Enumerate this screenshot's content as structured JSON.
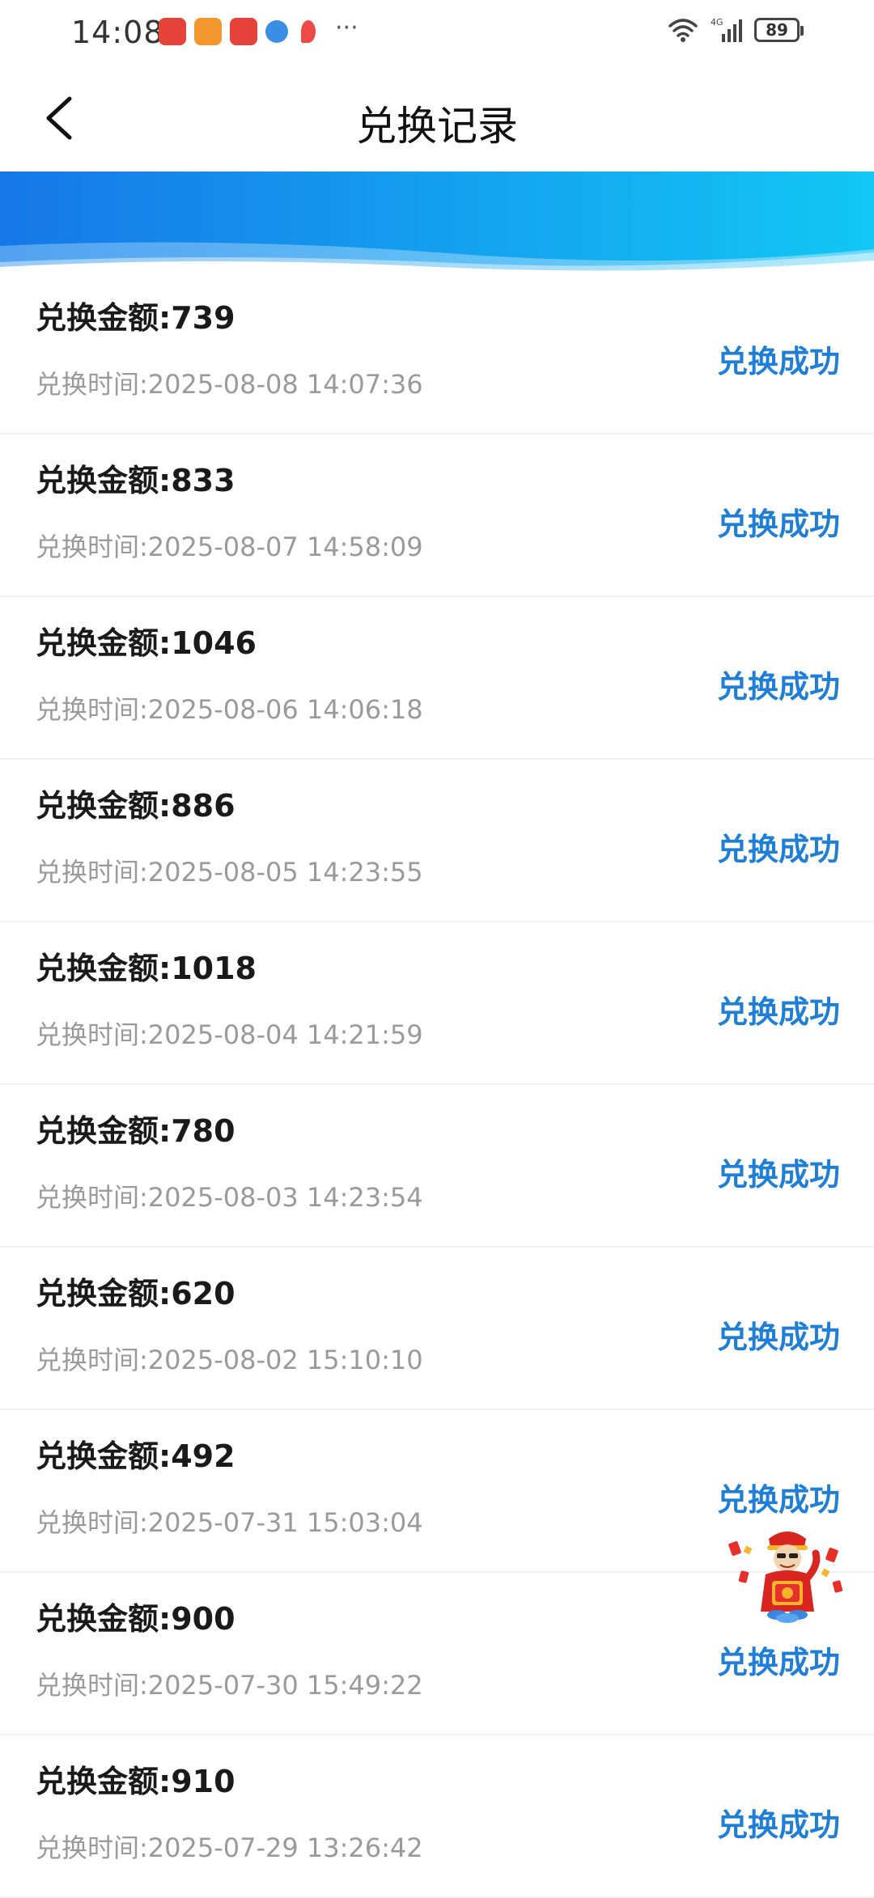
{
  "status_bar": {
    "time": "14:08",
    "network": "4G",
    "battery": "89"
  },
  "header": {
    "title": "兑换记录"
  },
  "records": [
    {
      "amount": "兑换金额:739",
      "time": "兑换时间:2025-08-08 14:07:36",
      "status": "兑换成功"
    },
    {
      "amount": "兑换金额:833",
      "time": "兑换时间:2025-08-07 14:58:09",
      "status": "兑换成功"
    },
    {
      "amount": "兑换金额:1046",
      "time": "兑换时间:2025-08-06 14:06:18",
      "status": "兑换成功"
    },
    {
      "amount": "兑换金额:886",
      "time": "兑换时间:2025-08-05 14:23:55",
      "status": "兑换成功"
    },
    {
      "amount": "兑换金额:1018",
      "time": "兑换时间:2025-08-04 14:21:59",
      "status": "兑换成功"
    },
    {
      "amount": "兑换金额:780",
      "time": "兑换时间:2025-08-03 14:23:54",
      "status": "兑换成功"
    },
    {
      "amount": "兑换金额:620",
      "time": "兑换时间:2025-08-02 15:10:10",
      "status": "兑换成功"
    },
    {
      "amount": "兑换金额:492",
      "time": "兑换时间:2025-07-31 15:03:04",
      "status": "兑换成功"
    },
    {
      "amount": "兑换金额:900",
      "time": "兑换时间:2025-07-30 15:49:22",
      "status": "兑换成功"
    },
    {
      "amount": "兑换金额:910",
      "time": "兑换时间:2025-07-29 13:26:42",
      "status": "兑换成功"
    }
  ],
  "colors": {
    "status_blue": "#1f7fd6",
    "banner_start": "#1677e8",
    "banner_end": "#12c7f5"
  },
  "icons": {
    "back": "chevron-left-icon",
    "mascot": "lucky-draw-mascot-icon"
  }
}
